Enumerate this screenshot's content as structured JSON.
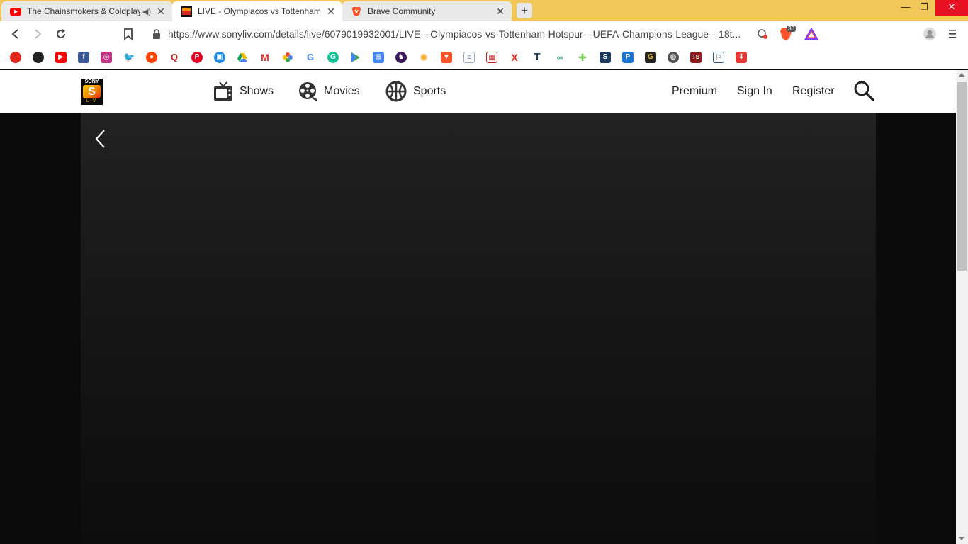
{
  "browser": {
    "tabs": [
      {
        "title": "The Chainsmokers & Coldplay",
        "favicon": "youtube-icon",
        "muted_indicator": "🔊",
        "close": "✕"
      },
      {
        "title": "LIVE - Olympiacos vs Tottenham H",
        "favicon": "sonyliv-icon",
        "close": "✕"
      },
      {
        "title": "Brave Community",
        "favicon": "brave-icon",
        "close": "✕"
      }
    ],
    "new_tab": "+",
    "window_controls": {
      "minimize": "—",
      "restore": "❐",
      "close": "✕"
    },
    "url": "https://www.sonyliv.com/details/live/6079019932001/LIVE---Olympiacos-vs-Tottenham-Hotspur---UEFA-Champions-League---18t...",
    "brave_shield_count": "30",
    "bookmarks": [
      "brave-rewards",
      "threads",
      "youtube",
      "facebook",
      "instagram",
      "twitter",
      "reddit",
      "quora",
      "pinterest",
      "google-meet",
      "google-drive",
      "gmail",
      "google-photos",
      "google",
      "grammarly",
      "google-play",
      "gdocs",
      "premier-league",
      "sun",
      "brave",
      "docs",
      "calendar",
      "x",
      "t2",
      "binoculars",
      "plus",
      "s",
      "p",
      "g",
      "globe",
      "ts",
      "runner",
      "download"
    ]
  },
  "site": {
    "nav": {
      "shows": "Shows",
      "movies": "Movies",
      "sports": "Sports"
    },
    "right": {
      "premium": "Premium",
      "sign_in": "Sign In",
      "register": "Register"
    },
    "logo": {
      "top": "SONY",
      "mark": "S",
      "bottom": "LIV"
    }
  },
  "colors": {
    "tabstrip": "#f2c75a",
    "page_bg": "#0b0b0b",
    "player_top": "#222222",
    "header_bg": "#ffffff"
  }
}
